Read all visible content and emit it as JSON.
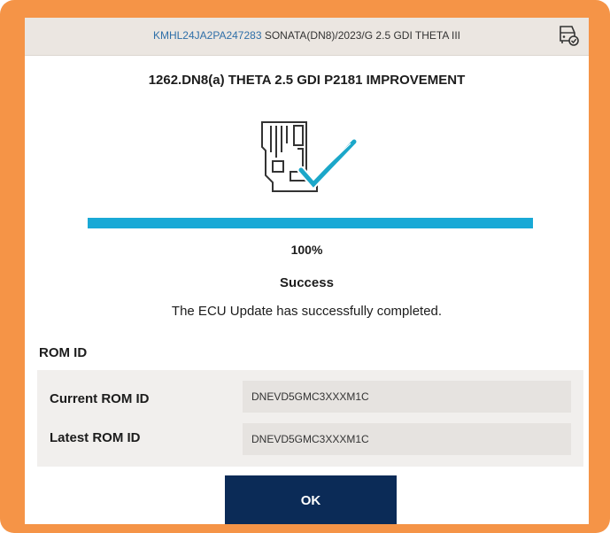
{
  "header": {
    "vin": "KMHL24JA2PA247283",
    "vehicle_info": "SONATA(DN8)/2023/G 2.5 GDI THETA III",
    "icon": "vehicle-check-icon"
  },
  "title": "1262.DN8(a) THETA 2.5 GDI P2181 IMPROVEMENT",
  "illustration_icon": "ecu-success-check-icon",
  "progress": {
    "fraction": 1.0,
    "label": "100%",
    "bar_color": "#19a9d6"
  },
  "status": "Success",
  "message": "The ECU Update has successfully completed.",
  "rom": {
    "heading": "ROM ID",
    "rows": [
      {
        "label": "Current ROM ID",
        "value": "DNEVD5GMC3XXXM1C"
      },
      {
        "label": "Latest ROM ID",
        "value": "DNEVD5GMC3XXXM1C"
      }
    ]
  },
  "ok_label": "OK",
  "colors": {
    "frame": "#f59447",
    "header_bg": "#ebe6e1",
    "vin_text": "#2f6fa8",
    "button_bg": "#0b2b57"
  }
}
